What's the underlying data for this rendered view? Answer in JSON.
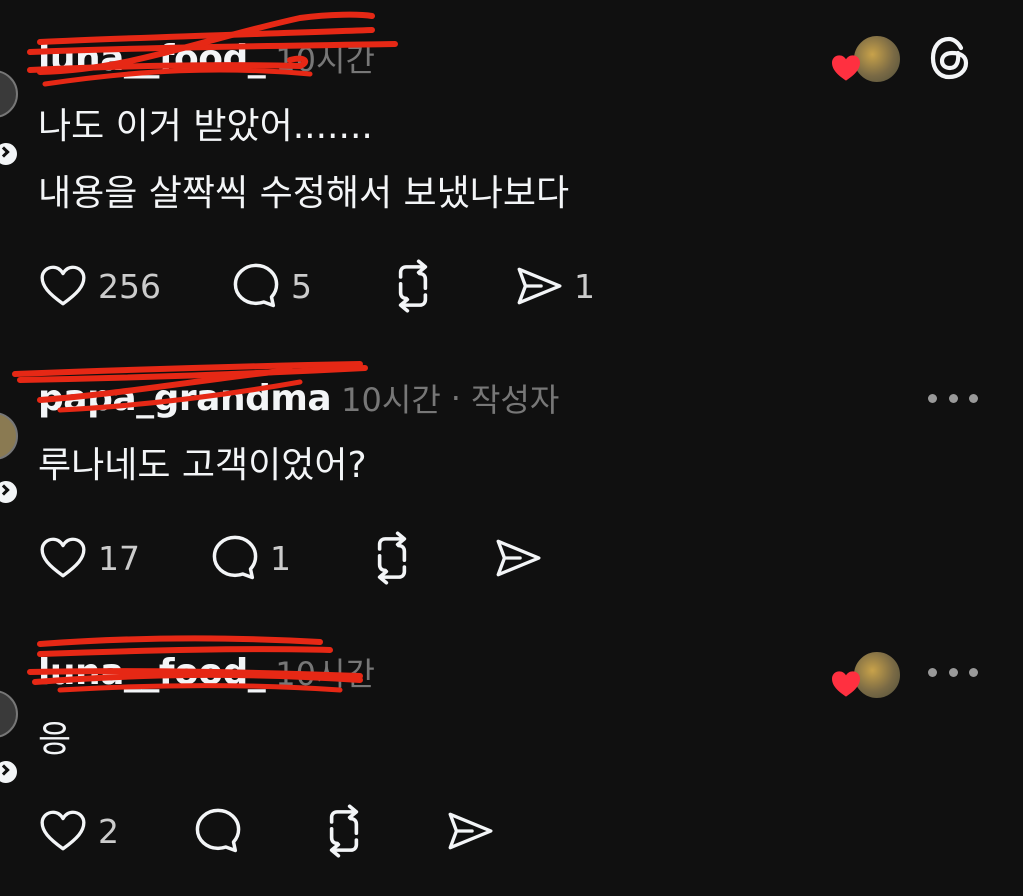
{
  "colors": {
    "background": "#101010",
    "text": "#f3f5f7",
    "muted": "#777777",
    "scribble": "#e62815",
    "like": "#ff3040"
  },
  "posts": [
    {
      "username": "luna__food_",
      "time": "10시간",
      "lines": [
        "나도 이거 받았어.......",
        "내용을 살짝씩 수정해서 보냈나보다"
      ],
      "liked_by_author": true,
      "top_right_icon": "threads-logo-icon",
      "likes": "256",
      "replies": "5",
      "reposts": "",
      "shares": "1"
    },
    {
      "username": "papa_grandma",
      "time": "10시간",
      "separator": "·",
      "author_badge": "작성자",
      "lines": [
        "루나네도 고객이었어?"
      ],
      "top_right_icon": "more-icon",
      "likes": "17",
      "replies": "1",
      "reposts": "",
      "shares": ""
    },
    {
      "username": "luna__food_",
      "time": "10시간",
      "lines": [
        "응"
      ],
      "liked_by_author": true,
      "top_right_icon": "more-icon",
      "likes": "2",
      "replies": "",
      "reposts": "",
      "shares": ""
    }
  ]
}
